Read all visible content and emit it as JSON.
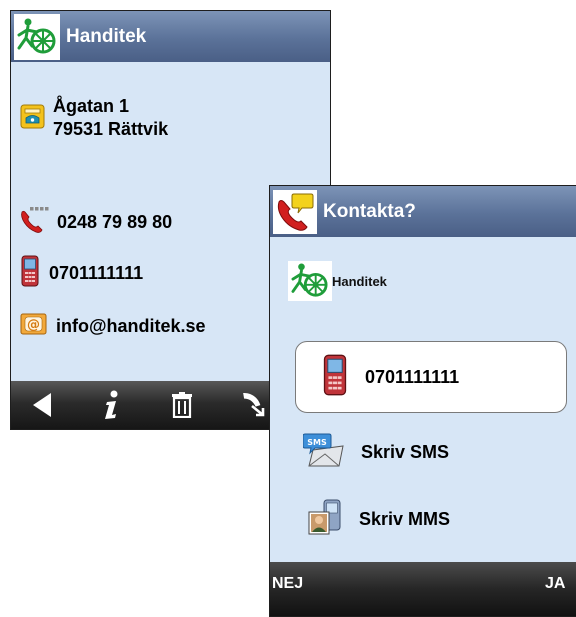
{
  "screen1": {
    "title": "Handitek",
    "address_line1": "Ågatan 1",
    "address_line2": "79531 Rättvik",
    "phone": "0248 79 89 80",
    "mobile": "0701111111",
    "email": "info@handitek.se",
    "toolbar_icons": [
      "back-icon",
      "info-icon",
      "delete-icon",
      "call-icon"
    ]
  },
  "screen2": {
    "title": "Kontakta?",
    "contact_name": "Handitek",
    "call_number": "0701111111",
    "sms_label": "Skriv SMS",
    "mms_label": "Skriv MMS",
    "softkey_left": "NEJ",
    "softkey_right": "JA"
  },
  "colors": {
    "screen_bg": "#d7e6f6",
    "titlebar": "#5b7299",
    "toolbar": "#1e1e1e",
    "logo_green": "#1f9d3a"
  }
}
